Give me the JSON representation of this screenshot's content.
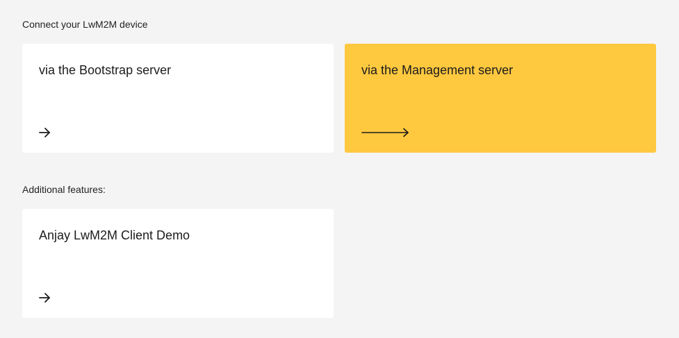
{
  "sections": {
    "connect": {
      "heading": "Connect your LwM2M device",
      "cards": [
        {
          "title": "via the Bootstrap server",
          "icon": "arrow-right-icon",
          "active": false
        },
        {
          "title": "via the Management server",
          "icon": "arrow-right-long-icon",
          "active": true
        }
      ]
    },
    "additional": {
      "heading": "Additional features:",
      "cards": [
        {
          "title": "Anjay LwM2M Client Demo",
          "icon": "arrow-right-icon",
          "active": false
        }
      ]
    }
  },
  "colors": {
    "background": "#f4f4f4",
    "card": "#ffffff",
    "active_card": "#fec83f",
    "text": "#1c1c1c"
  }
}
